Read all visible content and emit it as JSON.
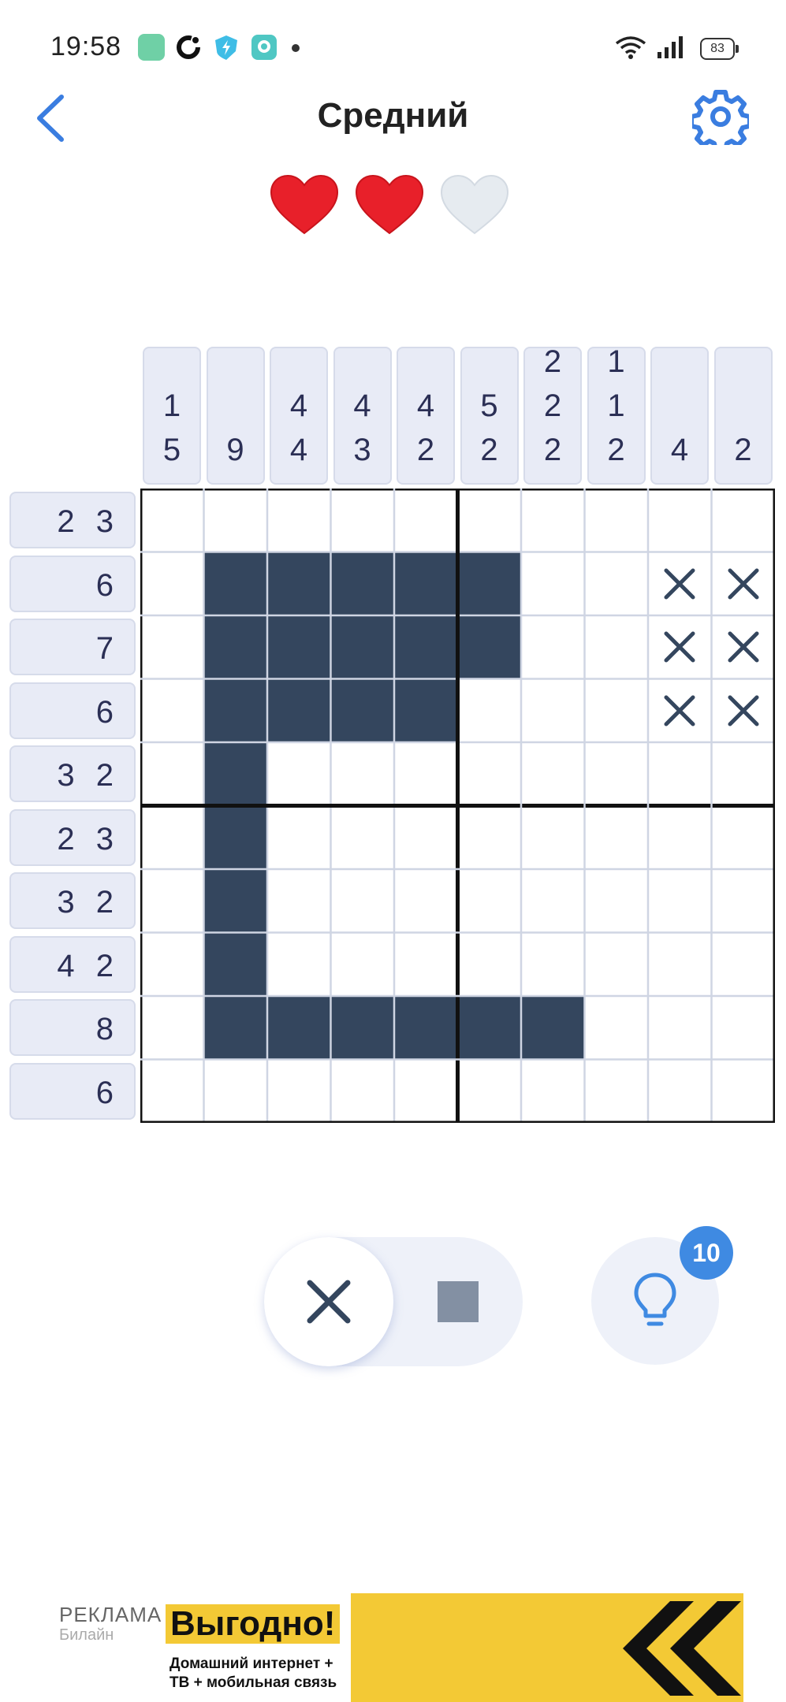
{
  "status_bar": {
    "time": "19:58",
    "battery": "83",
    "app_icons": [
      "green-app-icon",
      "circle-app-icon",
      "shield-app-icon",
      "chat-app-icon"
    ]
  },
  "header": {
    "title": "Средний",
    "back_icon": "chevron-left-icon",
    "settings_icon": "gear-icon",
    "accent_color": "#3a7de0"
  },
  "lives": {
    "total": 3,
    "remaining": 2,
    "full_color": "#e8202a",
    "empty_color": "#e6ebf0"
  },
  "puzzle": {
    "size": 10,
    "column_clues": [
      [
        "1",
        "5"
      ],
      [
        "9"
      ],
      [
        "4",
        "4"
      ],
      [
        "4",
        "3"
      ],
      [
        "4",
        "2"
      ],
      [
        "5",
        "2"
      ],
      [
        "2",
        "2",
        "2"
      ],
      [
        "1",
        "1",
        "2"
      ],
      [
        "4"
      ],
      [
        "2"
      ]
    ],
    "row_clues": [
      "2 3",
      "6",
      "7",
      "6",
      "3 2",
      "2 3",
      "3 2",
      "4 2",
      "8",
      "6"
    ],
    "grid": [
      [
        0,
        0,
        0,
        0,
        0,
        0,
        0,
        0,
        0,
        0
      ],
      [
        0,
        1,
        1,
        1,
        1,
        1,
        0,
        0,
        2,
        2
      ],
      [
        0,
        1,
        1,
        1,
        1,
        1,
        0,
        0,
        2,
        2
      ],
      [
        0,
        1,
        1,
        1,
        1,
        0,
        0,
        0,
        2,
        2
      ],
      [
        0,
        1,
        0,
        0,
        0,
        0,
        0,
        0,
        0,
        0
      ],
      [
        0,
        1,
        0,
        0,
        0,
        0,
        0,
        0,
        0,
        0
      ],
      [
        0,
        1,
        0,
        0,
        0,
        0,
        0,
        0,
        0,
        0
      ],
      [
        0,
        1,
        0,
        0,
        0,
        0,
        0,
        0,
        0,
        0
      ],
      [
        0,
        1,
        1,
        1,
        1,
        1,
        1,
        0,
        0,
        0
      ],
      [
        0,
        0,
        0,
        0,
        0,
        0,
        0,
        0,
        0,
        0
      ]
    ],
    "fill_color": "#34465e",
    "cross_color": "#34465e"
  },
  "controls": {
    "mode_selected": "cross",
    "cross_icon": "close-icon",
    "fill_icon": "square-icon",
    "hint_icon": "lightbulb-icon",
    "hint_count": "10"
  },
  "ad": {
    "label": "РЕКЛАМА",
    "brand": "Билайн",
    "headline": "Выгодно!",
    "text": "Домашний интернет + ТВ + мобильная связь"
  }
}
